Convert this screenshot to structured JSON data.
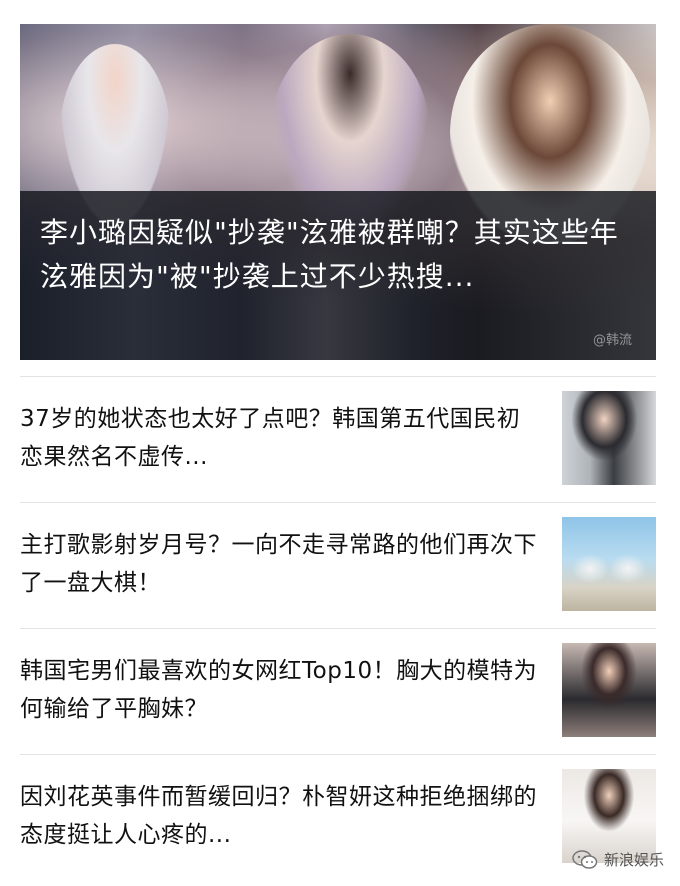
{
  "hero": {
    "title": "李小璐因疑似\"抄袭\"泫雅被群嘲？其实这些年泫雅因为\"被\"抄袭上过不少热搜...",
    "watermark": "@韩流"
  },
  "articles": [
    {
      "title": "37岁的她状态也太好了点吧？韩国第五代国民初恋果然名不虚传..."
    },
    {
      "title": "主打歌影射岁月号？一向不走寻常路的他们再次下了一盘大棋！"
    },
    {
      "title": "韩国宅男们最喜欢的女网红Top10！胸大的模特为何输给了平胸妹？"
    },
    {
      "title": "因刘花英事件而暂缓回归？朴智妍这种拒绝捆绑的态度挺让人心疼的..."
    }
  ],
  "brand": {
    "label": "新浪娱乐",
    "icon": "wechat-icon"
  }
}
